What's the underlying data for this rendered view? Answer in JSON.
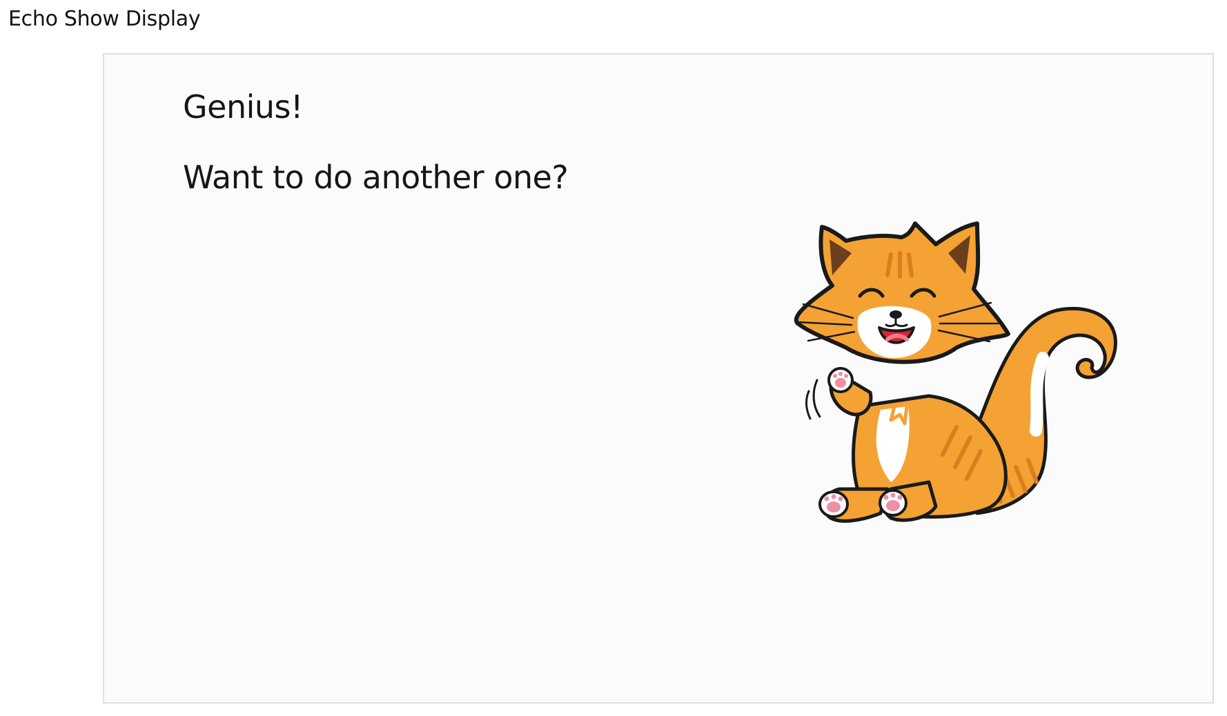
{
  "page": {
    "label": "Echo Show Display"
  },
  "display": {
    "headline": "Genius!",
    "prompt": "Want to do another one?",
    "illustration": "happy-cat-illustration"
  },
  "colors": {
    "screen_background": "#fbfbfb",
    "screen_border": "#e0e0e0",
    "cat_fur": "#f4a233",
    "cat_stripes": "#d97e1c",
    "cat_outline": "#1a1a1a",
    "cat_mouth": "#d8243a",
    "paw_pads": "#ee8fa3"
  }
}
